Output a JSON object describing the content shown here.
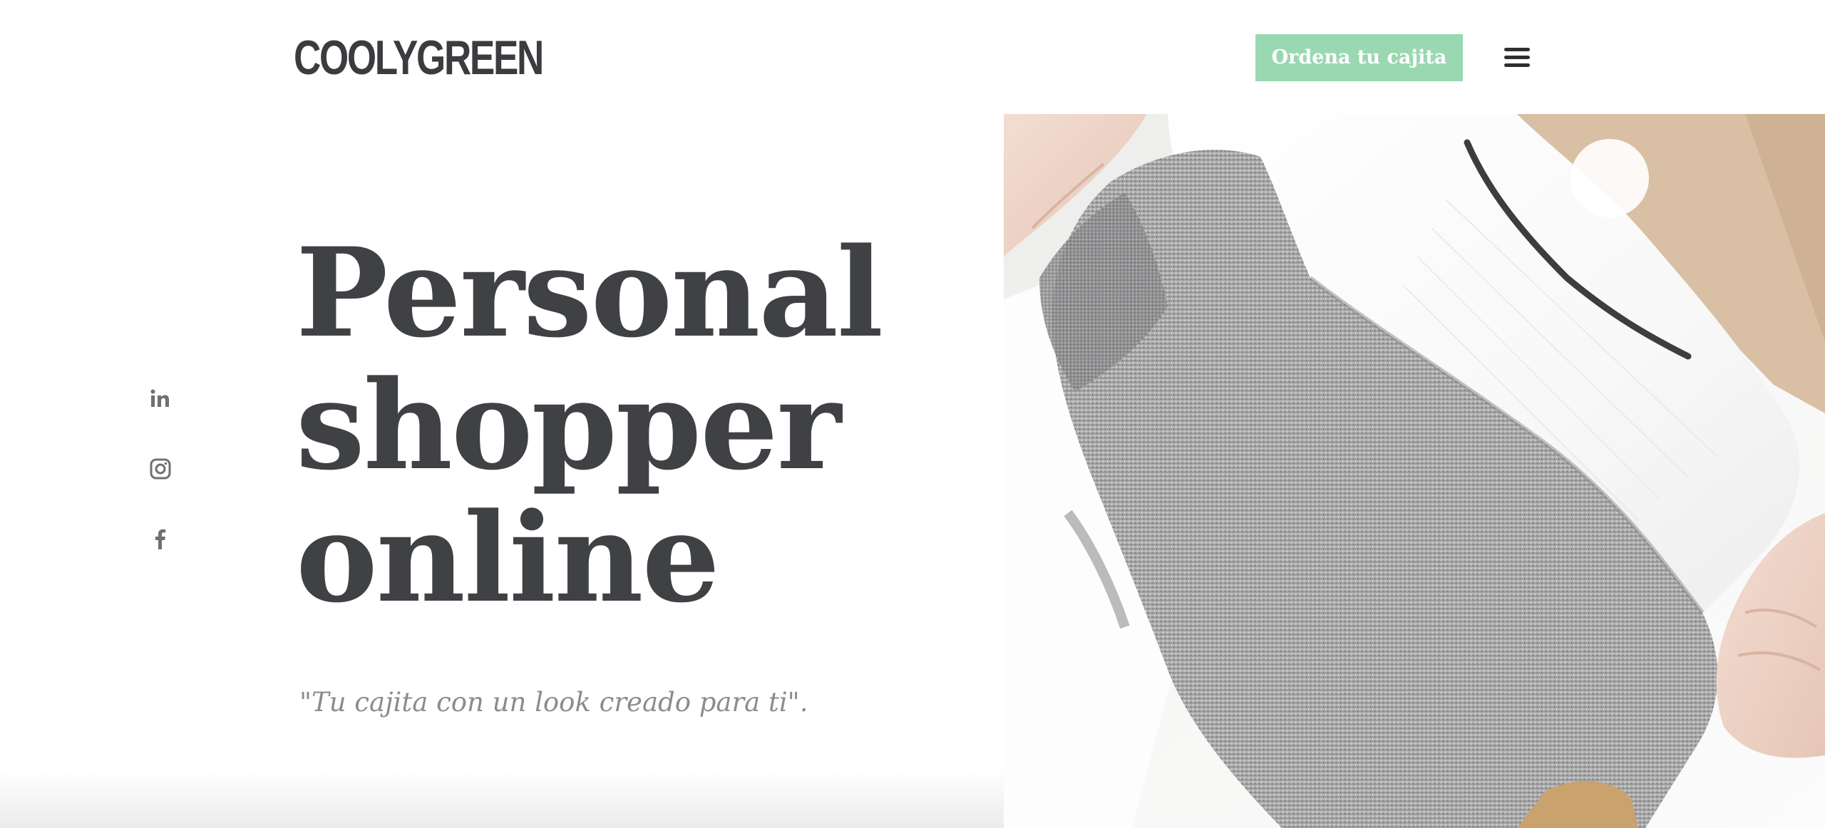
{
  "header": {
    "logo_text": "COOLYGREEN",
    "cta_label": "Ordena tu cajita",
    "menu_icon": "hamburger-menu-icon"
  },
  "social": {
    "items": [
      {
        "name": "linkedin",
        "icon": "linkedin-icon",
        "glyph": "in"
      },
      {
        "name": "instagram",
        "icon": "instagram-icon"
      },
      {
        "name": "facebook",
        "icon": "facebook-icon",
        "glyph": "f"
      }
    ]
  },
  "hero": {
    "title_lines": [
      "Personal",
      "shopper",
      "online"
    ],
    "subtitle": "\"Tu cajita con un look creado para ti\"."
  },
  "colors": {
    "accent": "#9ad8b2",
    "text_dark": "#3f4144",
    "text_muted": "#8a8c8e",
    "icon_gray": "#6e7073"
  }
}
